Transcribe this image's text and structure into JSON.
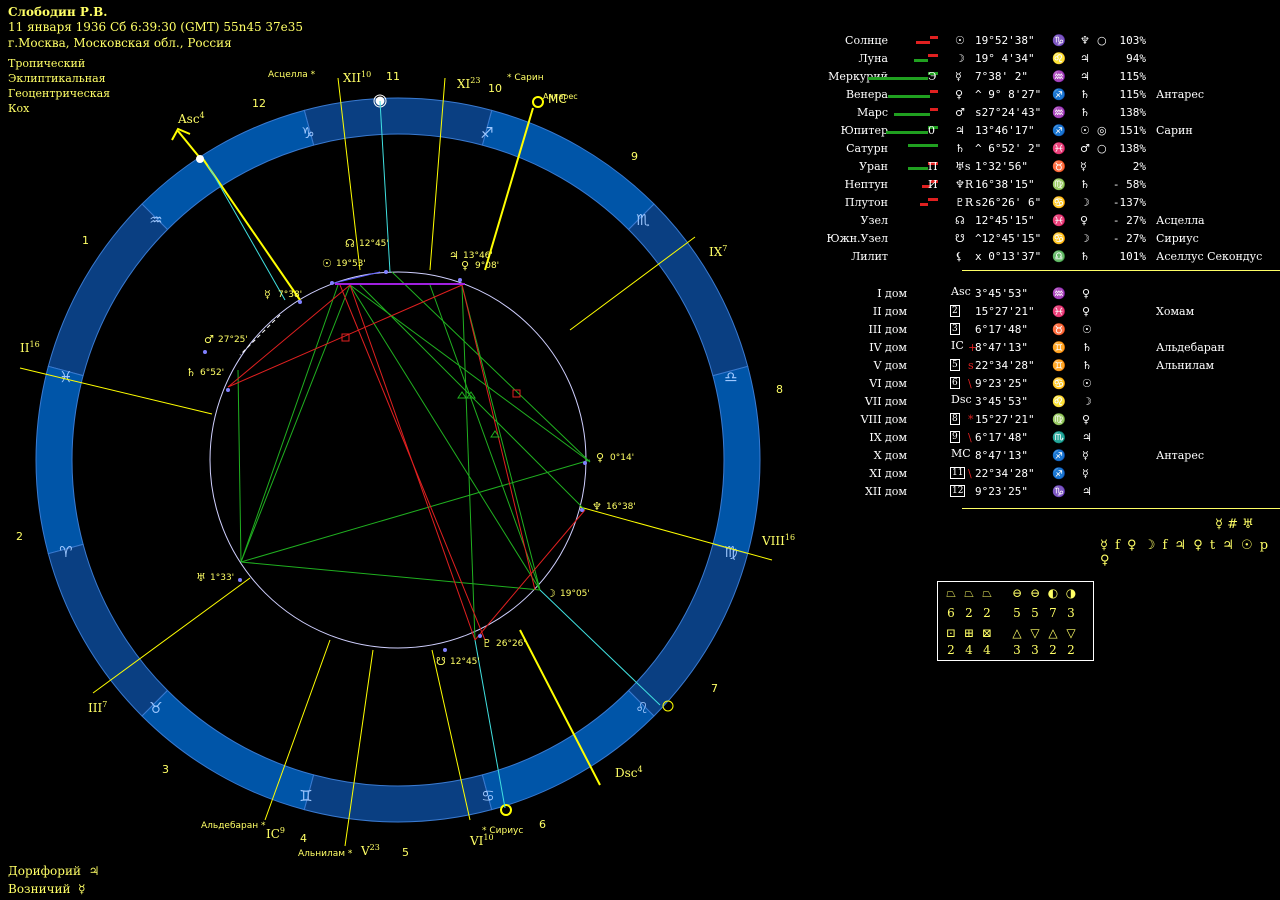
{
  "header": {
    "name": "Слободин Р.В.",
    "datetime": "11 января 1936  Сб   6:39:30 (GMT) 55n45  37e35",
    "place": "г.Москва, Московская обл., Россия"
  },
  "system": [
    "Тропический",
    "Эклиптикальная",
    "Геоцентрическая",
    "Кох"
  ],
  "footer": [
    {
      "label": "Дорифорий",
      "glyph": "♃"
    },
    {
      "label": "Возничий",
      "glyph": "☿"
    }
  ],
  "planets": [
    {
      "name": "Солнце",
      "bars": [
        {
          "c": "red",
          "w": 14
        },
        {
          "c": "red",
          "w": 8
        }
      ],
      "sgl": "",
      "glyph": "☉",
      "deg": "19°52'38\"",
      "sign": "♑",
      "ruler": "♆",
      "aspect": "○",
      "pct": "103%",
      "star": ""
    },
    {
      "name": "Луна",
      "bars": [
        {
          "c": "green",
          "w": 14
        },
        {
          "c": "red",
          "w": 10
        }
      ],
      "sgl": "",
      "glyph": "☽",
      "deg": "19° 4'34\"",
      "sign": "♌",
      "ruler": "♃",
      "aspect": "",
      "pct": "94%",
      "star": ""
    },
    {
      "name": "Меркурий",
      "bars": [
        {
          "c": "green",
          "w": 60
        },
        {
          "c": "green",
          "w": 10
        }
      ],
      "sgl": "Э",
      "glyph": "☿",
      "deg": " 7°38' 2\"",
      "sign": "♒",
      "ruler": "♃",
      "aspect": "",
      "pct": "115%",
      "star": ""
    },
    {
      "name": "Венера",
      "bars": [
        {
          "c": "green",
          "w": 42
        },
        {
          "c": "red",
          "w": 8
        }
      ],
      "sgl": "",
      "glyph": "♀",
      "deg": "^ 9° 8'27\"",
      "sign": "♐",
      "ruler": "♄",
      "aspect": "",
      "pct": "115%",
      "star": "Антарес"
    },
    {
      "name": "Марс",
      "bars": [
        {
          "c": "green",
          "w": 36
        },
        {
          "c": "red",
          "w": 8
        }
      ],
      "sgl": "",
      "glyph": "♂",
      "deg": "s27°24'43\"",
      "sign": "♒",
      "ruler": "♄",
      "aspect": "",
      "pct": "138%",
      "star": ""
    },
    {
      "name": "Юпитер",
      "bars": [
        {
          "c": "green",
          "w": 42
        },
        {
          "c": "green",
          "w": 10
        }
      ],
      "sgl": "0",
      "glyph": "♃",
      "deg": "13°46'17\"",
      "sign": "♐",
      "ruler": "☉",
      "aspect": "◎",
      "pct": "151%",
      "star": "Сарин"
    },
    {
      "name": "Сатурн",
      "bars": [
        {
          "c": "green",
          "w": 30
        }
      ],
      "sgl": "",
      "glyph": "♄",
      "deg": "^ 6°52' 2\"",
      "sign": "♓",
      "ruler": "♂",
      "aspect": "○",
      "pct": "138%",
      "star": ""
    },
    {
      "name": "Уран",
      "bars": [
        {
          "c": "green",
          "w": 20
        },
        {
          "c": "red",
          "w": 10
        }
      ],
      "sgl": "П",
      "glyph": "♅s",
      "deg": " 1°32'56\"",
      "sign": "♉",
      "ruler": "☿",
      "aspect": "",
      "pct": "2%",
      "star": ""
    },
    {
      "name": "Нептун",
      "bars": [
        {
          "c": "red",
          "w": 8
        },
        {
          "c": "red",
          "w": 8
        }
      ],
      "sgl": "И",
      "glyph": "♆R",
      "deg": "16°38'15\"",
      "sign": "♍",
      "ruler": "♄",
      "aspect": "",
      "pct": "- 58%",
      "star": ""
    },
    {
      "name": "Плутон",
      "bars": [
        {
          "c": "red",
          "w": 8
        },
        {
          "c": "red",
          "w": 10
        }
      ],
      "sgl": "",
      "glyph": "♇R",
      "deg": "s26°26' 6\"",
      "sign": "♋",
      "ruler": "☽",
      "aspect": "",
      "pct": "-137%",
      "star": ""
    },
    {
      "name": "Узел",
      "bars": [],
      "sgl": "",
      "glyph": "☊",
      "deg": " 12°45'15\"",
      "sign": "♓",
      "ruler": "♀",
      "aspect": "",
      "pct": "- 27%",
      "star": "Асцелла"
    },
    {
      "name": "Южн.Узел",
      "bars": [],
      "sgl": "",
      "glyph": "☋",
      "deg": "^12°45'15\"",
      "sign": "♋",
      "ruler": "☽",
      "aspect": "",
      "pct": "- 27%",
      "star": "Сириус"
    },
    {
      "name": "Лилит",
      "bars": [],
      "sgl": "",
      "glyph": "⚸",
      "deg": "x 0°13'37\"",
      "sign": "♎",
      "ruler": "♄",
      "aspect": "",
      "pct": "101%",
      "star": "Аселлус Секондус"
    }
  ],
  "houses": [
    {
      "name": "I дом",
      "lbl": "Asc",
      "box": false,
      "mark": "",
      "deg": "3°45'53\"",
      "sign": "♒",
      "ruler": "♀",
      "star": ""
    },
    {
      "name": "II дом",
      "lbl": "2",
      "box": true,
      "mark": "",
      "deg": "15°27'21\"",
      "sign": "♓",
      "ruler": "♀",
      "star": "Хомам"
    },
    {
      "name": "III дом",
      "lbl": "3",
      "box": true,
      "mark": "",
      "deg": "6°17'48\"",
      "sign": "♉",
      "ruler": "☉",
      "star": ""
    },
    {
      "name": "IV дом",
      "lbl": "IC",
      "box": false,
      "mark": "+",
      "deg": "8°47'13\"",
      "sign": "♊",
      "ruler": "♄",
      "star": "Альдебаран"
    },
    {
      "name": "V дом",
      "lbl": "5",
      "box": true,
      "mark": "s",
      "deg": "22°34'28\"",
      "sign": "♊",
      "ruler": "♄",
      "star": "Альнилам"
    },
    {
      "name": "VI дом",
      "lbl": "6",
      "box": true,
      "mark": "\\",
      "deg": "9°23'25\"",
      "sign": "♋",
      "ruler": "☉",
      "star": ""
    },
    {
      "name": "VII дом",
      "lbl": "Dsc",
      "box": false,
      "mark": "",
      "deg": "3°45'53\"",
      "sign": "♌",
      "ruler": "☽",
      "star": ""
    },
    {
      "name": "VIII дом",
      "lbl": "8",
      "box": true,
      "mark": "*",
      "deg": "15°27'21\"",
      "sign": "♍",
      "ruler": "♀",
      "star": ""
    },
    {
      "name": "IX дом",
      "lbl": "9",
      "box": true,
      "mark": "\\",
      "deg": "6°17'48\"",
      "sign": "♏",
      "ruler": "♃",
      "star": ""
    },
    {
      "name": "X дом",
      "lbl": "MC",
      "box": false,
      "mark": "",
      "deg": "8°47'13\"",
      "sign": "♐",
      "ruler": "☿",
      "star": "Антарес"
    },
    {
      "name": "XI дом",
      "lbl": "11",
      "box": true,
      "mark": "\\",
      "deg": "22°34'28\"",
      "sign": "♐",
      "ruler": "☿",
      "star": ""
    },
    {
      "name": "XII дом",
      "lbl": "12",
      "box": true,
      "mark": "",
      "deg": "9°23'25\"",
      "sign": "♑",
      "ruler": "♃",
      "star": ""
    }
  ],
  "aspect_line1": "☿ # ♅",
  "aspect_line2": "☿ f ♀   ☽ f ♃   ♀ t ♃   ☉ p ♀",
  "elements": {
    "row1_glyphs": [
      "⏢",
      "⏢",
      "⏢",
      "⊖",
      "⊖",
      "◐",
      "◑"
    ],
    "row1_vals": [
      "6",
      "2",
      "2",
      "5",
      "5",
      "7",
      "3"
    ],
    "row2_glyphs": [
      "⊡",
      "⊞",
      "⊠",
      "△",
      "▽",
      "△",
      "▽"
    ],
    "row2_vals": [
      "2",
      "4",
      "4",
      "3",
      "3",
      "2",
      "2"
    ]
  },
  "chart_labels": {
    "signs": [
      "♑",
      "♐",
      "♏",
      "♎",
      "♍",
      "♌",
      "♋",
      "♊",
      "♉",
      "♈",
      "♓",
      "♒"
    ],
    "house_numbers": [
      "1",
      "2",
      "3",
      "4",
      "5",
      "6",
      "7",
      "8",
      "9",
      "10",
      "11",
      "12"
    ],
    "cusp_labels": {
      "asc": "Asc4",
      "mc": "MC",
      "dsc": "Dsc4",
      "ic": "IC9",
      "ii": "II16",
      "iii": "III7",
      "v": "V23",
      "vi": "VI10",
      "viii": "VIII16",
      "ix": "IX7",
      "xi": "XI23",
      "xii": "XII10"
    },
    "stars": [
      "Асцелла *",
      "* Сарин",
      "Антарес",
      "* Аселлус Секондус",
      "Альдебаран *",
      "Альнилам *",
      "* Сириус"
    ],
    "planet_degrees": [
      "19°53'",
      "12°45'",
      "13°46'",
      "9°08'",
      "7°38'",
      "27°25'",
      "6°52'",
      "0°14'",
      "16°38'",
      "19°05'",
      "26°26'",
      "12°45'",
      "1°33'"
    ]
  }
}
